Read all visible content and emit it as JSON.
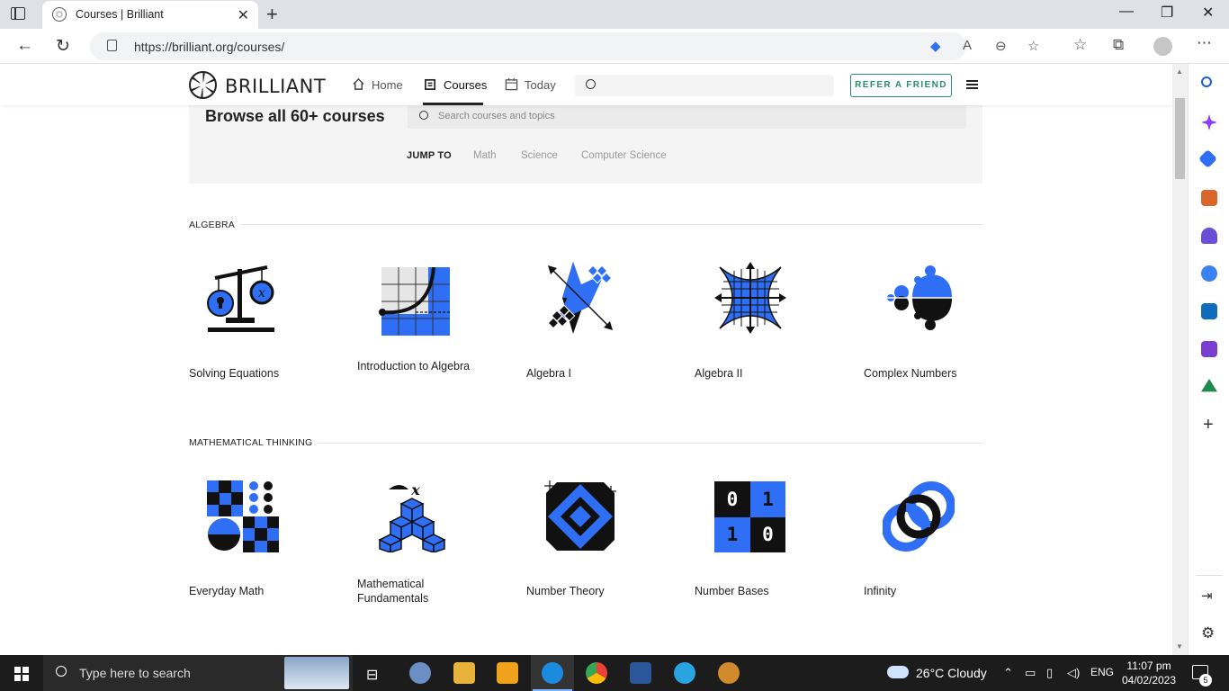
{
  "browser": {
    "tab_title": "Courses | Brilliant",
    "url": "https://brilliant.org/courses/"
  },
  "header": {
    "logo_text": "BRILLIANT",
    "nav": [
      {
        "label": "Home",
        "icon": "home-icon"
      },
      {
        "label": "Courses",
        "icon": "courses-icon",
        "active": true
      },
      {
        "label": "Today",
        "icon": "calendar-icon"
      }
    ],
    "refer_label": "REFER A FRIEND"
  },
  "browse": {
    "title": "Browse all 60+ courses",
    "search_placeholder": "Search courses and topics",
    "jump_label": "JUMP TO",
    "jump_links": [
      "Math",
      "Science",
      "Computer Science"
    ]
  },
  "sections": [
    {
      "title": "ALGEBRA",
      "courses": [
        "Solving Equations",
        "Introduction to Algebra",
        "Algebra I",
        "Algebra II",
        "Complex Numbers"
      ]
    },
    {
      "title": "MATHEMATICAL THINKING",
      "courses": [
        "Everyday Math",
        "Mathematical Fundamentals",
        "Number Theory",
        "Number Bases",
        "Infinity"
      ]
    }
  ],
  "number_bases_digits": [
    "0",
    "1",
    "1",
    "0"
  ],
  "taskbar": {
    "search_placeholder": "Type here to search",
    "weather": "26°C  Cloudy",
    "language": "ENG",
    "time": "11:07 pm",
    "date": "04/02/2023",
    "notifications": "5"
  },
  "colors": {
    "brand_blue": "#2f6ff5",
    "accent_green": "#2b8b6f",
    "panel_gray": "#f4f4f4"
  }
}
